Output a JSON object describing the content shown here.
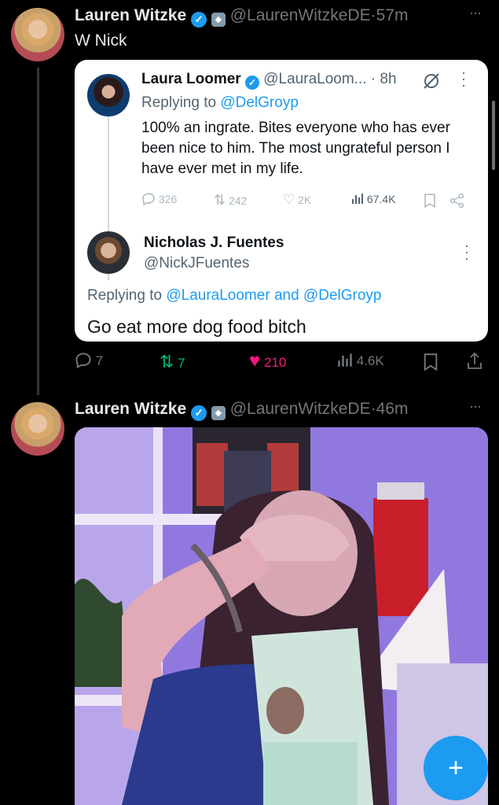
{
  "tweet1": {
    "name": "Lauren Witzke",
    "handle": "@LaurenWitzkeDE",
    "sep": "·",
    "time": "57m",
    "text": "W Nick",
    "more": "···"
  },
  "quote": {
    "outer": {
      "name": "Laura Loomer",
      "handle": "@LauraLoom...",
      "sep": "·",
      "time": "8h",
      "replying_prefix": "Replying to",
      "replying_to": "@DelGroyp",
      "text": "100% an ingrate. Bites everyone who has ever been nice to him. The most ungrateful person I have ever met in my life.",
      "stats": {
        "replies": "326",
        "reposts": "242",
        "likes": "2K",
        "views": "67.4K"
      }
    },
    "inner": {
      "name": "Nicholas J. Fuentes",
      "handle": "@NickJFuentes",
      "replying_prefix": "Replying to",
      "replying_to_1": "@LauraLoomer",
      "and": "and",
      "replying_to_2": "@DelGroyp",
      "text": "Go eat more dog food bitch"
    }
  },
  "tweet1_actions": {
    "replies": "7",
    "reposts": "7",
    "likes": "210",
    "views": "4.6K"
  },
  "tweet2": {
    "name": "Lauren Witzke",
    "handle": "@LaurenWitzkeDE",
    "sep": "·",
    "time": "46m",
    "more": "···"
  },
  "fab": {
    "label": "+"
  },
  "colors": {
    "accent": "#1d9bf0",
    "like": "#f91880",
    "repost": "#00ba7c"
  }
}
